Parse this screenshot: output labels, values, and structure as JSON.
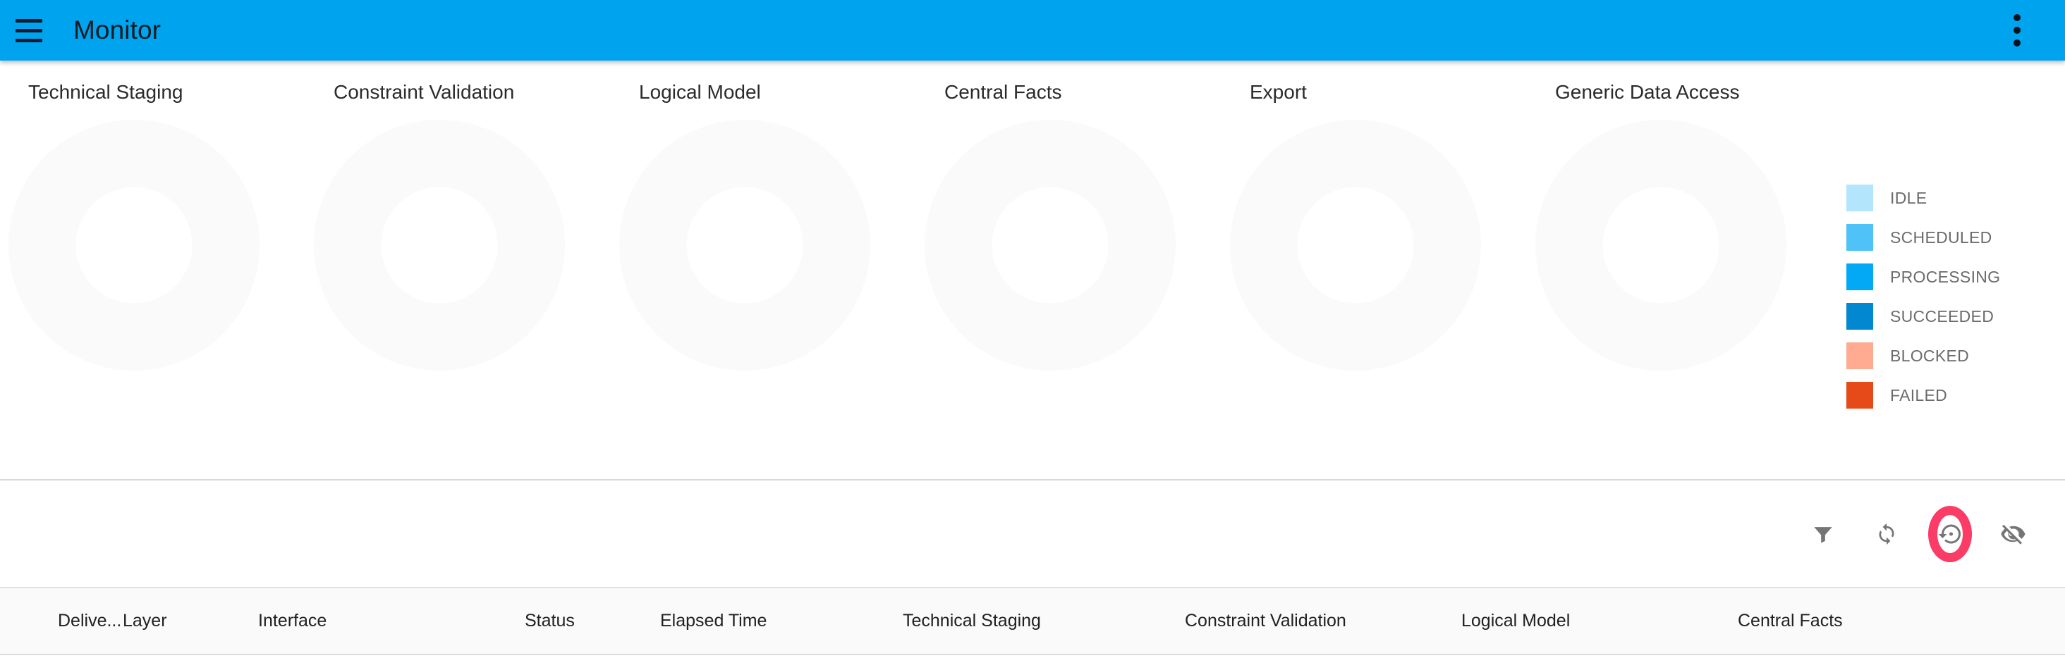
{
  "appbar": {
    "menu_icon": "hamburger-menu-icon",
    "title": "Monitor",
    "overflow_icon": "more-vert-icon",
    "background_color": "#00a3ed"
  },
  "charts": {
    "items": [
      {
        "title": "Technical Staging"
      },
      {
        "title": "Constraint Validation"
      },
      {
        "title": "Logical Model"
      },
      {
        "title": "Central Facts"
      },
      {
        "title": "Export"
      },
      {
        "title": "Generic Data Access"
      }
    ]
  },
  "legend": {
    "items": [
      {
        "label": "IDLE",
        "color": "#b3e5fc"
      },
      {
        "label": "SCHEDULED",
        "color": "#4fc3f7"
      },
      {
        "label": "PROCESSING",
        "color": "#03a9f4"
      },
      {
        "label": "SUCCEEDED",
        "color": "#0288d1"
      },
      {
        "label": "BLOCKED",
        "color": "#ffab91"
      },
      {
        "label": "FAILED",
        "color": "#e64a19"
      }
    ]
  },
  "toolbar": {
    "filter_icon": "filter-icon",
    "refresh_icon": "refresh-icon",
    "restore_icon": "restore-history-icon",
    "hide_icon": "eye-off-icon",
    "highlight_color": "#fa3c67",
    "icon_color": "#757575"
  },
  "table": {
    "columns": [
      "Delive...",
      "Layer",
      "Interface",
      "Status",
      "Elapsed Time",
      "Technical Staging",
      "Constraint Validation",
      "Logical Model",
      "Central Facts"
    ]
  },
  "chart_data": {
    "type": "pie",
    "title": "Interface status by layer",
    "charts": [
      {
        "name": "Technical Staging",
        "categories": [
          "IDLE",
          "SCHEDULED",
          "PROCESSING",
          "SUCCEEDED",
          "BLOCKED",
          "FAILED"
        ],
        "values": [
          0,
          0,
          0,
          0,
          0,
          0
        ]
      },
      {
        "name": "Constraint Validation",
        "categories": [
          "IDLE",
          "SCHEDULED",
          "PROCESSING",
          "SUCCEEDED",
          "BLOCKED",
          "FAILED"
        ],
        "values": [
          0,
          0,
          0,
          0,
          0,
          0
        ]
      },
      {
        "name": "Logical Model",
        "categories": [
          "IDLE",
          "SCHEDULED",
          "PROCESSING",
          "SUCCEEDED",
          "BLOCKED",
          "FAILED"
        ],
        "values": [
          0,
          0,
          0,
          0,
          0,
          0
        ]
      },
      {
        "name": "Central Facts",
        "categories": [
          "IDLE",
          "SCHEDULED",
          "PROCESSING",
          "SUCCEEDED",
          "BLOCKED",
          "FAILED"
        ],
        "values": [
          0,
          0,
          0,
          0,
          0,
          0
        ]
      },
      {
        "name": "Export",
        "categories": [
          "IDLE",
          "SCHEDULED",
          "PROCESSING",
          "SUCCEEDED",
          "BLOCKED",
          "FAILED"
        ],
        "values": [
          0,
          0,
          0,
          0,
          0,
          0
        ]
      },
      {
        "name": "Generic Data Access",
        "categories": [
          "IDLE",
          "SCHEDULED",
          "PROCESSING",
          "SUCCEEDED",
          "BLOCKED",
          "FAILED"
        ],
        "values": [
          0,
          0,
          0,
          0,
          0,
          0
        ]
      }
    ],
    "legend": [
      "IDLE",
      "SCHEDULED",
      "PROCESSING",
      "SUCCEEDED",
      "BLOCKED",
      "FAILED"
    ],
    "legend_position": "right",
    "colors": [
      "#b3e5fc",
      "#4fc3f7",
      "#03a9f4",
      "#0288d1",
      "#ffab91",
      "#e64a19"
    ],
    "note": "All six donut charts are empty (no data) and render as flat light-grey rings."
  }
}
